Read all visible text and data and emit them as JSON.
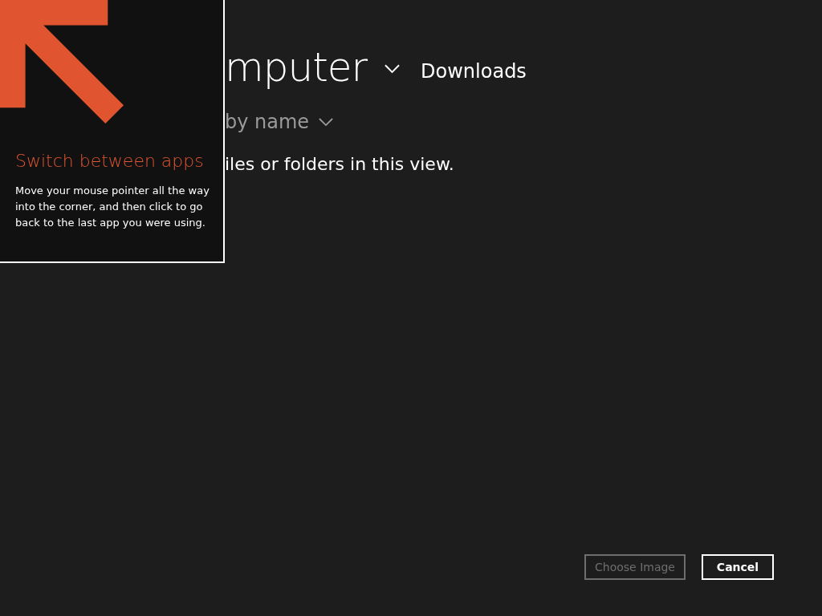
{
  "location": {
    "title": "mputer",
    "folder": "Downloads"
  },
  "sort": {
    "label": "by name"
  },
  "message": "iles or folders in this view.",
  "buttons": [
    {
      "label": "Choose Image",
      "disabled": true
    },
    {
      "label": "Cancel",
      "disabled": false
    }
  ],
  "tip": {
    "title": "Switch between apps",
    "body": "Move your mouse pointer all the way into the corner, and then click to go back to the last app you were using."
  }
}
